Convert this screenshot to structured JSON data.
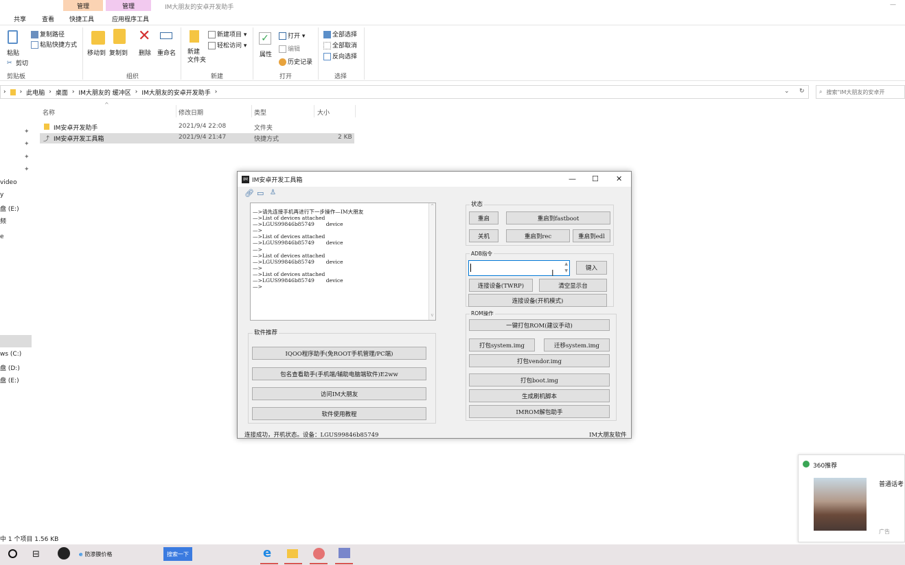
{
  "explorer": {
    "context_tabs": [
      "管理",
      "管理"
    ],
    "window_title": "IM大朋友的安卓开发助手",
    "ribbon_tabs": [
      "共享",
      "查看",
      "快捷工具",
      "应用程序工具"
    ],
    "clipboard": {
      "paste": "粘贴",
      "copy_path": "复制路径",
      "paste_shortcut": "粘贴快捷方式",
      "cut": "剪切",
      "group": "剪贴板"
    },
    "organize": {
      "move_to": "移动到",
      "copy_to": "复制到",
      "delete": "删除",
      "rename": "重命名",
      "group": "组织"
    },
    "new": {
      "new_folder_line1": "新建",
      "new_folder_line2": "文件夹",
      "new_item": "新建项目 ▾",
      "easy_access": "轻松访问 ▾",
      "group": "新建"
    },
    "open": {
      "properties": "属性",
      "open": "打开 ▾",
      "edit": "编辑",
      "history": "历史记录",
      "group": "打开"
    },
    "select": {
      "select_all": "全部选择",
      "select_none": "全部取消",
      "invert": "反向选择",
      "group": "选择"
    },
    "breadcrumb": [
      "此电脑",
      "桌面",
      "IM大朋友的 缓冲区",
      "IM大朋友的安卓开发助手"
    ],
    "search_placeholder": "搜索\"IM大朋友的安卓开",
    "columns": {
      "name": "名称",
      "modified": "修改日期",
      "type": "类型",
      "size": "大小"
    },
    "files": [
      {
        "name": "IM安卓开发助手",
        "modified": "2021/9/4 22:08",
        "type": "文件夹",
        "size": ""
      },
      {
        "name": "IM安卓开发工具箱",
        "modified": "2021/9/4 21:47",
        "type": "快捷方式",
        "size": "2 KB"
      }
    ],
    "nav_items": [
      "video",
      "y",
      "盘 (E:)",
      "频",
      "e",
      "ws (C:)",
      "盘 (D:)",
      "盘 (E:)"
    ],
    "status_bar": "中 1 个项目  1.56 KB"
  },
  "app": {
    "title": "IM安卓开发工具箱",
    "icon_text": "IM",
    "log_text": "—>请先连接手机再进行下一步操作—IM大朋友\n—>List of devices attached\n—>LGUS99846b85749       device\n—>\n—>List of devices attached\n—>LGUS99846b85749       device\n—>\n—>List of devices attached\n—>LGUS99846b85749       device\n—>\n—>List of devices attached\n—>LGUS99846b85749       device\n—>",
    "status_group": "状态",
    "btn_reboot": "重启",
    "btn_reboot_fastboot": "重启到fastboot",
    "btn_shutdown": "关机",
    "btn_reboot_rec": "重启到rec",
    "btn_reboot_edl": "重启到edl",
    "adb_group": "ADB指令",
    "btn_enter": "键入",
    "btn_connect_twrp": "连接设备(TWRP)",
    "btn_clear": "清空显示台",
    "btn_connect_boot": "连接设备(开机模式)",
    "rom_group": "ROM操作",
    "btn_pack_rom": "一键打包ROM(建议手动)",
    "btn_pack_system": "打包system.img",
    "btn_move_system": "迁移system.img",
    "btn_pack_vendor": "打包vendor.img",
    "btn_pack_boot": "打包boot.img",
    "btn_gen_script": "生成刷机脚本",
    "btn_unpack": "IMROM解包助手",
    "soft_group": "软件推荐",
    "btn_iqoo": "IQOO程序助手(免ROOT手机管理/PC端)",
    "btn_pkg": "包名查看助手(手机端/辅助电脑端软件)E2ww",
    "btn_visit": "访问IM大朋友",
    "btn_tutorial": "软件使用教程",
    "status_left": "连接成功，开机状态。设备：LGUS99846b85749",
    "status_right": "IM大朋友软件"
  },
  "ad": {
    "header": "360推荐",
    "text": "普通话考",
    "label": "广告"
  },
  "taskbar": {
    "item_text": "防渗膜价格",
    "search_btn": "搜索一下"
  }
}
